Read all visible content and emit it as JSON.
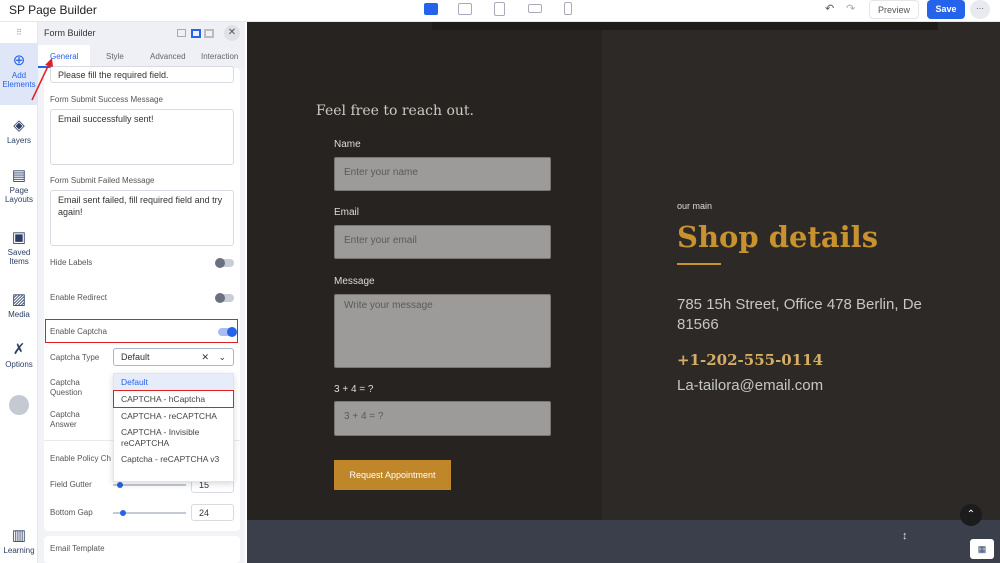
{
  "topbar": {
    "title": "SP Page Builder",
    "preview": "Preview",
    "save": "Save",
    "more": "···"
  },
  "rail": [
    {
      "label": "Add Elements"
    },
    {
      "label": "Layers"
    },
    {
      "label": "Page Layouts"
    },
    {
      "label": "Saved Items"
    },
    {
      "label": "Media"
    },
    {
      "label": "Options"
    },
    {
      "label": "Learning"
    }
  ],
  "panel": {
    "title": "Form Builder",
    "tabs": [
      "General",
      "Style",
      "Advanced",
      "Interaction"
    ],
    "required_msg": "Please fill the required field.",
    "success_label": "Form Submit Success Message",
    "success_value": "Email successfully sent!",
    "failed_label": "Form Submit Failed Message",
    "failed_value": "Email sent failed, fill required field and try again!",
    "hide_labels": "Hide Labels",
    "enable_redirect": "Enable Redirect",
    "enable_captcha": "Enable Captcha",
    "captcha_type_label": "Captcha Type",
    "captcha_type_value": "Default",
    "captcha_question": "Captcha Question",
    "captcha_answer": "Captcha Answer",
    "policy": "Enable Policy Ch",
    "field_gutter": "Field Gutter",
    "field_gutter_value": "15",
    "field_gutter_pct": 0.05,
    "bottom_gap": "Bottom Gap",
    "bottom_gap_value": "24",
    "bottom_gap_pct": 0.1,
    "email_template": "Email Template",
    "options": [
      "Default",
      "CAPTCHA - hCaptcha",
      "CAPTCHA - reCAPTCHA",
      "CAPTCHA - Invisible reCAPTCHA",
      "Captcha - reCAPTCHA v3"
    ]
  },
  "form": {
    "heading": "Feel free to reach out.",
    "name_label": "Name",
    "name_ph": "Enter your name",
    "email_label": "Email",
    "email_ph": "Enter your email",
    "message_label": "Message",
    "message_ph": "Write your message",
    "captcha_label": "3 + 4 = ?",
    "captcha_ph": "3 + 4 = ?",
    "submit": "Request Appointment"
  },
  "shop": {
    "kicker": "our main",
    "title": "Shop details",
    "address": "785 15h Street, Office 478 Berlin, De 81566",
    "phone": "+1-202-555-0114",
    "email": "La-tailora@email.com"
  },
  "colors": {
    "accent": "#2563eb",
    "gold": "#c8922e"
  }
}
